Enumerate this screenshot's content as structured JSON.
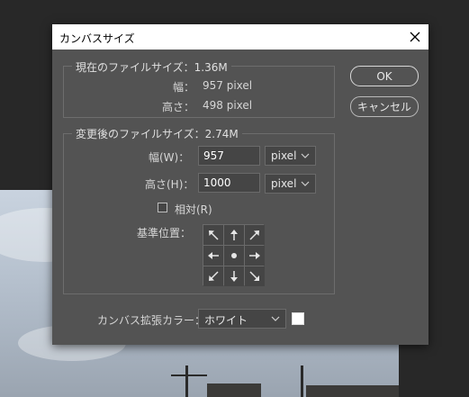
{
  "dialog": {
    "title": "カンバスサイズ",
    "ok_label": "OK",
    "cancel_label": "キャンセル"
  },
  "current_size": {
    "legend": "現在のファイルサイズ：1.36M",
    "width_label": "幅：",
    "width_value": "957 pixel",
    "height_label": "高さ：",
    "height_value": "498 pixel"
  },
  "new_size": {
    "legend": "変更後のファイルサイズ：2.74M",
    "width_label": "幅(W)：",
    "width_value": "957",
    "width_unit": "pixel",
    "height_label": "高さ(H)：",
    "height_value": "1000",
    "height_unit": "pixel",
    "relative_label": "相対(R)",
    "relative_checked": false,
    "anchor_label": "基準位置："
  },
  "extension": {
    "label": "カンバス拡張カラー：",
    "value": "ホワイト",
    "swatch_color": "#ffffff"
  },
  "icons": {
    "close": "close-icon",
    "anchor_arrows": [
      "arrow-up-left-icon",
      "arrow-up-icon",
      "arrow-up-right-icon",
      "arrow-left-icon",
      "anchor-center-dot-icon",
      "arrow-right-icon",
      "arrow-down-left-icon",
      "arrow-down-icon",
      "arrow-down-right-icon"
    ]
  }
}
